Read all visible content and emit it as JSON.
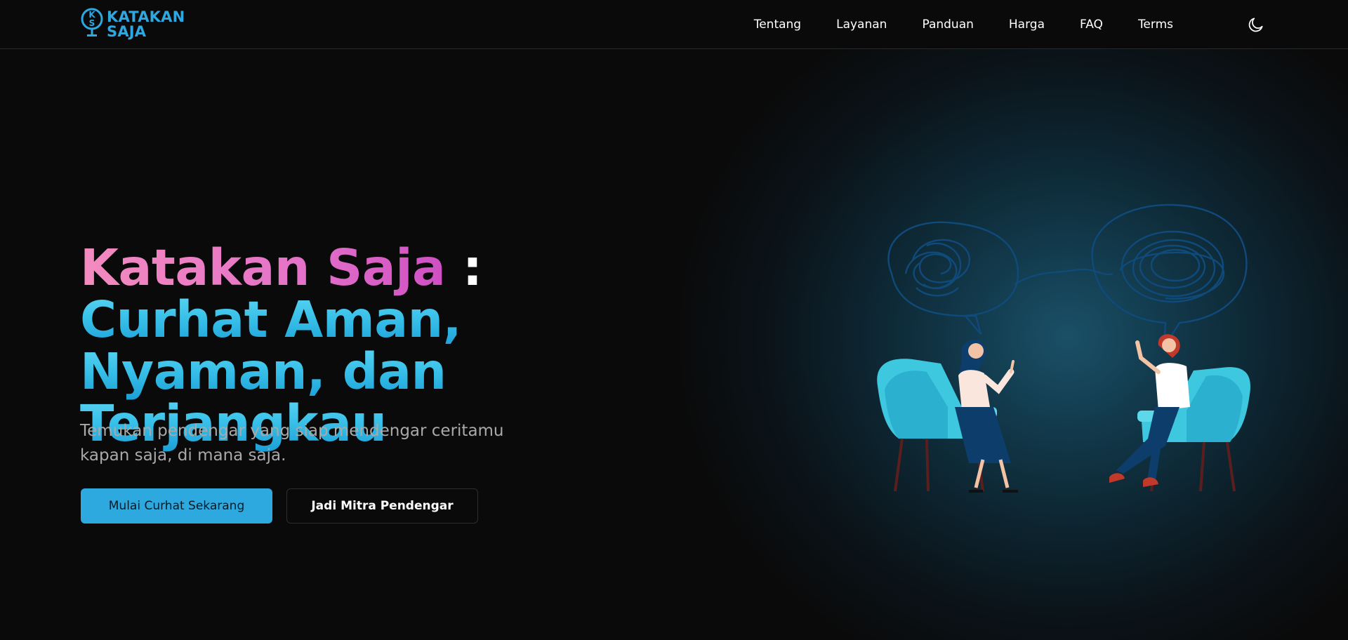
{
  "brand": {
    "name_line1": "KATAKAN",
    "name_line2": "SAJA",
    "mark_letters": "KS",
    "color": "#2ea8e0"
  },
  "nav": {
    "items": [
      {
        "label": "Tentang"
      },
      {
        "label": "Layanan"
      },
      {
        "label": "Panduan"
      },
      {
        "label": "Harga"
      },
      {
        "label": "FAQ"
      },
      {
        "label": "Terms"
      }
    ],
    "theme_toggle_icon": "moon-icon"
  },
  "hero": {
    "title_part1": "Katakan Saja",
    "title_colon": ":",
    "title_part2": "Curhat Aman, Nyaman, dan Terjangkau",
    "subtitle": "Temukan pendengar yang siap mendengar ceritamu kapan saja, di mana saja.",
    "primary_button": "Mulai Curhat Sekarang",
    "secondary_button": "Jadi Mitra Pendengar"
  },
  "colors": {
    "background": "#0a0a0a",
    "accent": "#2da9df",
    "title_pink": "#e472c8",
    "title_blue": "#37bfe8",
    "chair": "#3ec8e0"
  },
  "illustration": {
    "icon": "two-people-talking-illustration"
  }
}
